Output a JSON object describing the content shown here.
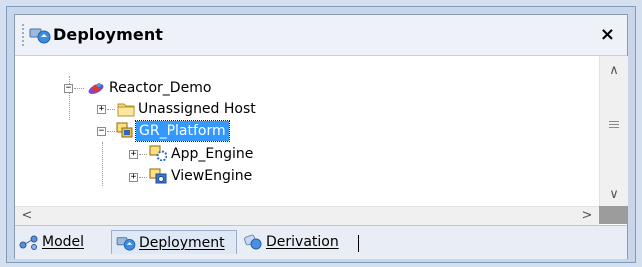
{
  "panel": {
    "title": "Deployment",
    "close_label": "×"
  },
  "tree": {
    "nodes": [
      {
        "label": "Reactor_Demo",
        "icon": "galaxy-icon",
        "expanded": true
      },
      {
        "label": "Unassigned Host",
        "icon": "folder-icon",
        "expanded": false
      },
      {
        "label": "GR_Platform",
        "icon": "platform-icon",
        "expanded": true,
        "selected": true
      },
      {
        "label": "App_Engine",
        "icon": "engine-icon",
        "expanded": false
      },
      {
        "label": "ViewEngine",
        "icon": "view-engine-icon",
        "expanded": false
      }
    ]
  },
  "tabs": [
    {
      "label": "Model",
      "icon": "model-icon",
      "active": false
    },
    {
      "label": "Deployment",
      "icon": "deployment-icon",
      "active": true
    },
    {
      "label": "Derivation",
      "icon": "derivation-icon",
      "active": false
    }
  ],
  "colors": {
    "selection": "#3399ff",
    "frame": "#c9d6ea"
  }
}
